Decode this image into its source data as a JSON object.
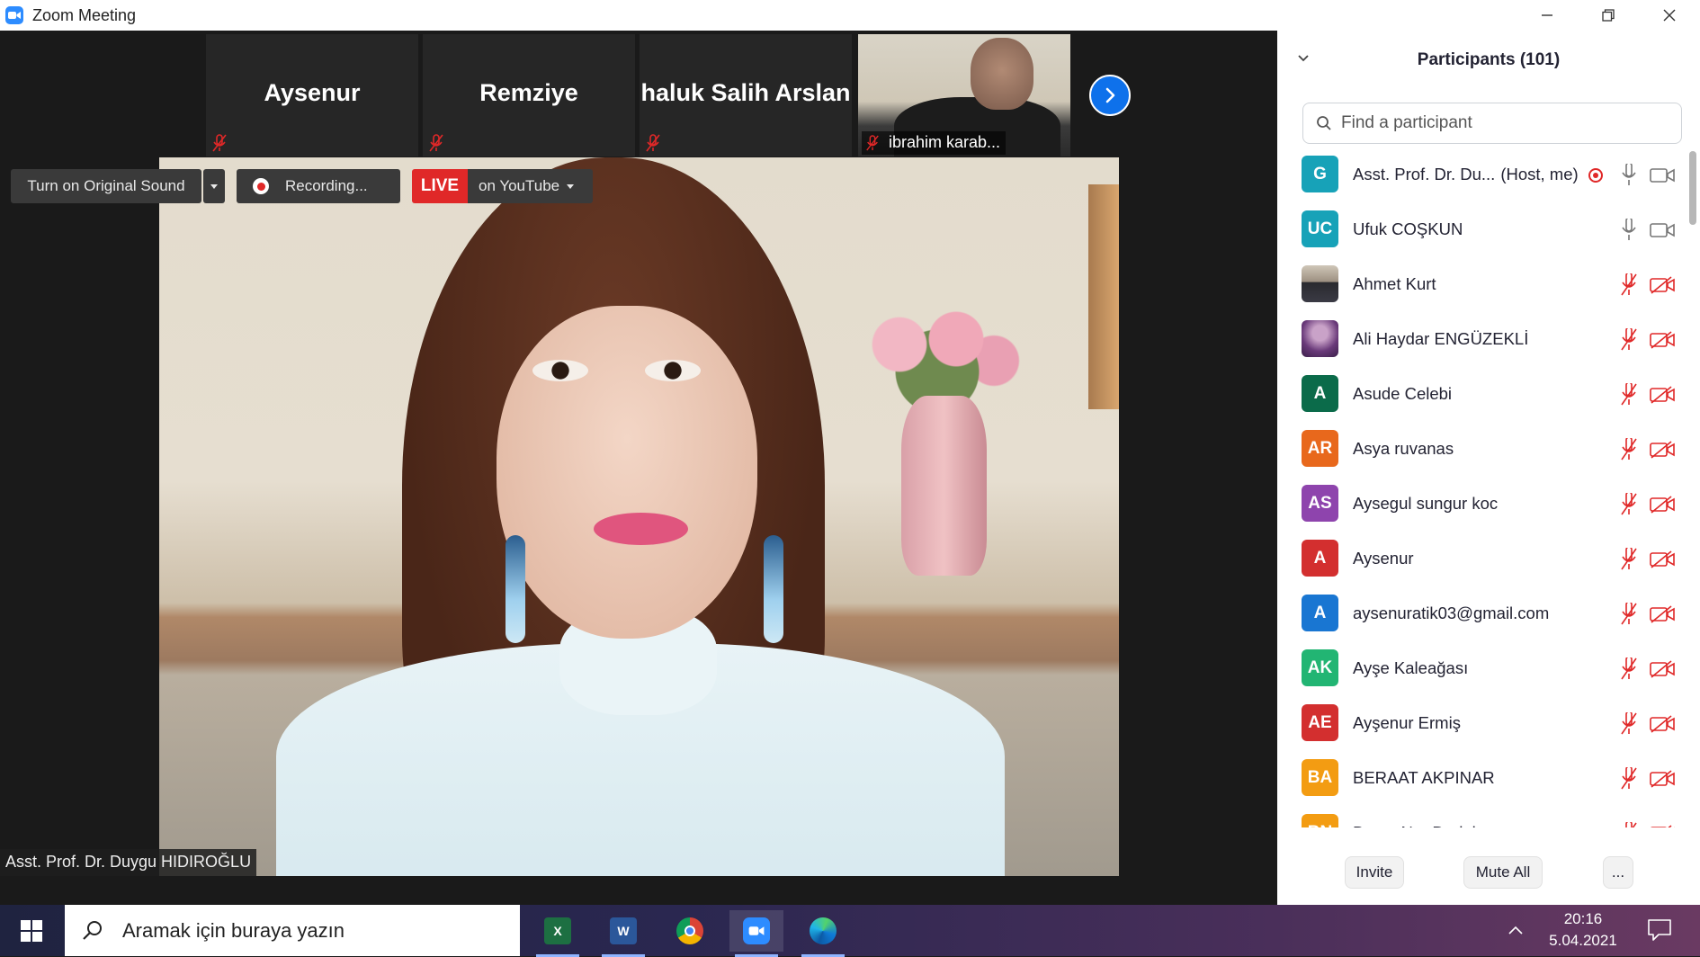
{
  "window": {
    "title": "Zoom Meeting",
    "controls": [
      "minimize",
      "restore",
      "close"
    ]
  },
  "strip": {
    "tiles": [
      {
        "name": "Aysenur",
        "muted": true
      },
      {
        "name": "Remziye",
        "muted": true
      },
      {
        "name": "haluk Salih Arslan",
        "muted": true
      }
    ],
    "video_tile": {
      "name": "ibrahim karab...",
      "muted": true
    },
    "next_icon": "chevron-right-icon"
  },
  "toolbar": {
    "original_sound": "Turn on Original Sound",
    "recording": "Recording...",
    "live": "LIVE",
    "live_target": "on YouTube"
  },
  "speaker": {
    "label": "Asst. Prof. Dr. Duygu HIDIROĞLU"
  },
  "panel": {
    "title": "Participants (101)",
    "search_placeholder": "Find a participant",
    "participants": [
      {
        "initials": "G",
        "name": "Asst. Prof. Dr. Du...",
        "host_tag": "(Host, me)",
        "color": "#17a2b8",
        "recording": true,
        "mic": "on",
        "video": "on"
      },
      {
        "initials": "UC",
        "name": "Ufuk COŞKUN",
        "color": "#17a2b8",
        "mic": "on",
        "video": "on"
      },
      {
        "initials": "",
        "name": "Ahmet Kurt",
        "photo": "photo1",
        "mic": "muted",
        "video": "off"
      },
      {
        "initials": "",
        "name": "Ali Haydar ENGÜZEKLİ",
        "photo": "photo2",
        "mic": "muted",
        "video": "off"
      },
      {
        "initials": "A",
        "name": "Asude Celebi",
        "color": "#0b6b4a",
        "mic": "muted",
        "video": "off"
      },
      {
        "initials": "AR",
        "name": "Asya ruvanas",
        "color": "#e8681c",
        "mic": "muted",
        "video": "off"
      },
      {
        "initials": "AS",
        "name": "Aysegul sungur koc",
        "color": "#8e44ad",
        "mic": "muted",
        "video": "off"
      },
      {
        "initials": "A",
        "name": "Aysenur",
        "color": "#d32f2f",
        "mic": "muted",
        "video": "off"
      },
      {
        "initials": "A",
        "name": "aysenuratik03@gmail.com",
        "color": "#1976d2",
        "mic": "muted",
        "video": "off"
      },
      {
        "initials": "AK",
        "name": "Ayşe Kaleağası",
        "color": "#22b573",
        "mic": "muted",
        "video": "off"
      },
      {
        "initials": "AE",
        "name": "Ayşenur Ermiş",
        "color": "#d32f2f",
        "mic": "muted",
        "video": "off"
      },
      {
        "initials": "BA",
        "name": "BERAAT AKPINAR",
        "color": "#f39c12",
        "mic": "muted",
        "video": "off"
      },
      {
        "initials": "BN",
        "name": "Busra Nur Dodak",
        "color": "#f39c12",
        "mic": "muted",
        "video": "off"
      }
    ],
    "buttons": {
      "invite": "Invite",
      "mute_all": "Mute All",
      "more": "..."
    }
  },
  "taskbar": {
    "search_placeholder": "Aramak için buraya yazın",
    "apps": [
      {
        "name": "excel",
        "letter": "X",
        "color": "#1d6f42"
      },
      {
        "name": "word",
        "letter": "W",
        "color": "#2b579a"
      },
      {
        "name": "chrome",
        "letter": "",
        "color": "#db4437"
      },
      {
        "name": "zoom",
        "letter": "",
        "color": "#2d8cff"
      },
      {
        "name": "edge",
        "letter": "",
        "color": "#0f7bd8"
      }
    ],
    "time": "20:16",
    "date": "5.04.2021"
  }
}
